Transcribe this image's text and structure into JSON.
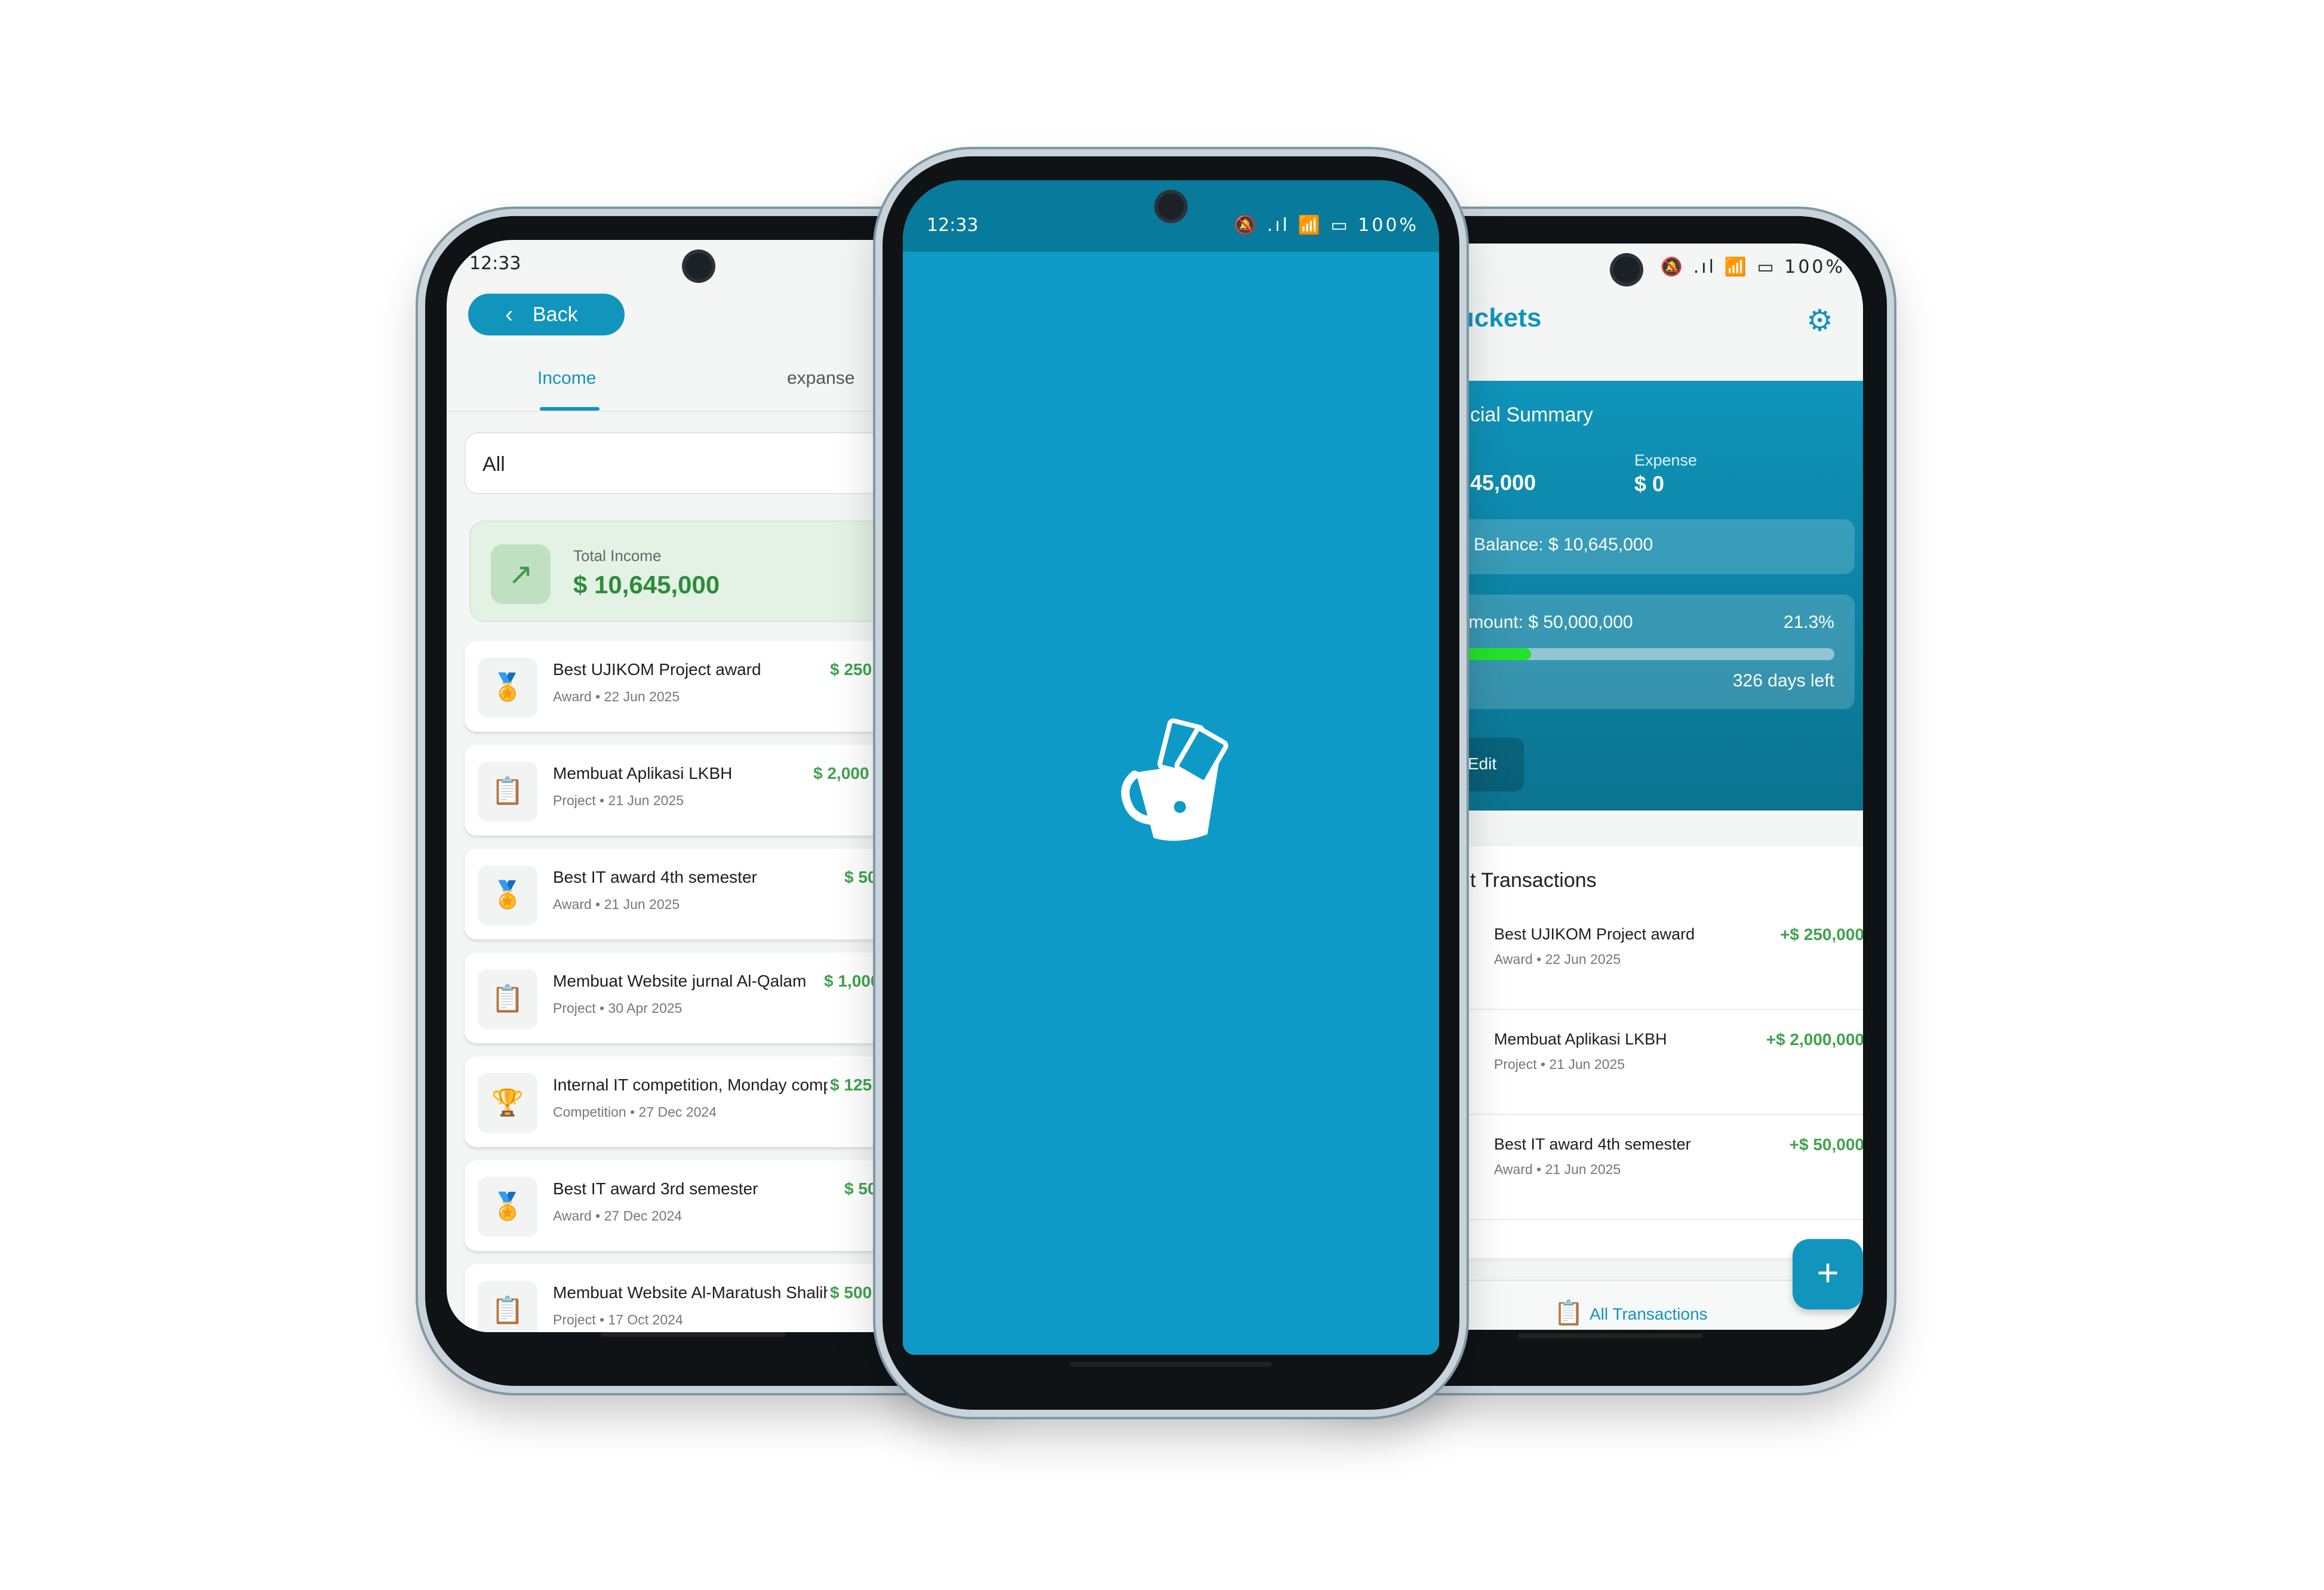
{
  "status_bar": {
    "time": "12:33",
    "icons": "🔕 .ıl 📶 ▭ 100%"
  },
  "left_screen": {
    "back_label": "Back",
    "tabs": [
      {
        "label": "Income"
      },
      {
        "label": "expanse"
      }
    ],
    "filter_value": "All",
    "total_income": {
      "label": "Total Income",
      "value": "$ 10,645,000"
    },
    "transactions": [
      {
        "title": "Best UJIKOM Project award",
        "subtitle": "Award • 22 Jun 2025",
        "amount": "$ 250",
        "icon": "🏅"
      },
      {
        "title": "Membuat Aplikasi LKBH",
        "subtitle": "Project • 21 Jun 2025",
        "amount": "$ 2,000",
        "icon": "📋"
      },
      {
        "title": "Best IT award 4th semester",
        "subtitle": "Award • 21 Jun 2025",
        "amount": "$ 50",
        "icon": "🏅"
      },
      {
        "title": "Membuat Website jurnal Al-Qalam",
        "subtitle": "Project • 30 Apr 2025",
        "amount": "$ 1,000",
        "icon": "📋"
      },
      {
        "title": "Internal IT competition, Monday comp...",
        "subtitle": "Competition • 27 Dec 2024",
        "amount": "$ 125",
        "icon": "🏆"
      },
      {
        "title": "Best IT award 3rd semester",
        "subtitle": "Award • 27 Dec 2024",
        "amount": "$ 50",
        "icon": "🏅"
      },
      {
        "title": "Membuat Website Al-Maratush Shalih...",
        "subtitle": "Project • 17 Oct 2024",
        "amount": "$ 500",
        "icon": "📋"
      }
    ]
  },
  "right_screen": {
    "title": "uckets",
    "summary": {
      "heading": "cial Summary",
      "income_value": "45,000",
      "expense_label": "Expense",
      "expense_value": "$ 0",
      "balance": "Balance: $ 10,645,000",
      "goal_amount": "l Amount: $ 50,000,000",
      "goal_percent": "21.3%",
      "goal_progress": 0.213,
      "days_left": "326 days left",
      "edit_label": "Edit"
    },
    "recent_heading": "t Transactions",
    "recent": [
      {
        "title": "Best UJIKOM Project award",
        "subtitle": "Award • 22 Jun 2025",
        "amount": "+$ 250,000"
      },
      {
        "title": "Membuat Aplikasi LKBH",
        "subtitle": "Project • 21 Jun 2025",
        "amount": "+$ 2,000,000"
      },
      {
        "title": "Best IT award 4th semester",
        "subtitle": "Award • 21 Jun 2025",
        "amount": "+$ 50,000"
      }
    ],
    "fab_label": "+",
    "bottom_nav_label": "All Transactions"
  },
  "colors": {
    "accent": "#1195bd",
    "splash": "#0e9ac7",
    "income_green": "#3fa34d"
  }
}
